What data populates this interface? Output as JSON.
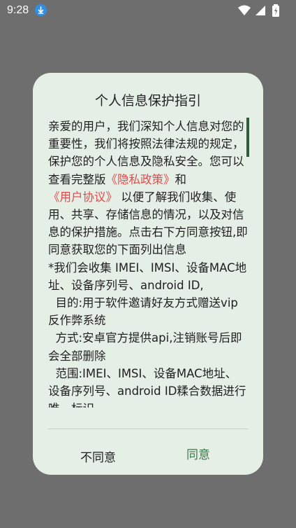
{
  "status_bar": {
    "time": "9:28",
    "icons": [
      "download-icon",
      "wifi-icon",
      "signal-icon",
      "battery-icon"
    ]
  },
  "dialog": {
    "title": "个人信息保护指引",
    "intro": "亲爱的用户，我们深知个人信息对您的重要性，我们将按照法律法规的规定，保护您的个人信息及隐私安全。您可以查看完整版",
    "privacy_link": "《隐私政策》",
    "and_text": "和",
    "agreement_link": "《用户协议》",
    "body": "以便了解我们收集、使用、共享、存储信息的情况，以及对信息的保护措施。点击右下方同意按钮,即同意获取您的下面列出信息\n*我们会收集 IMEI、IMSI、设备MAC地址、设备序列号、android ID,\n  目的:用于软件邀请好友方式赠送vip反作弊系统\n  方式:安卓官方提供api,注销账号后即会全部删除\n  范围:IMEI、IMSI、设备MAC地址、设备序列号、android ID糅合数据进行唯一标识",
    "disagree_label": "不同意",
    "agree_label": "同意"
  },
  "colors": {
    "overlay": "#6e6e6e",
    "dialog_bg": "#e6efe6",
    "link": "#e2494a",
    "agree": "#3a7a4a",
    "scroll_thumb": "#2e5e3a",
    "download_badge": "#2f8fe6"
  }
}
